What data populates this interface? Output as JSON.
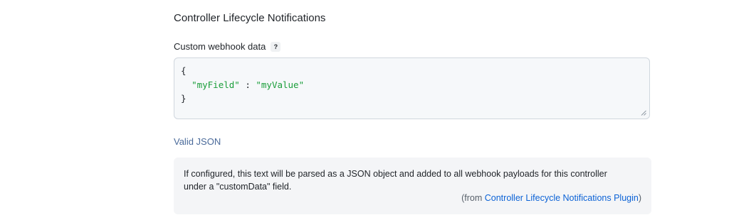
{
  "section": {
    "title": "Controller Lifecycle Notifications"
  },
  "field": {
    "label": "Custom webhook data",
    "help_icon_glyph": "?",
    "help_icon": "question-icon"
  },
  "editor": {
    "lines": {
      "open": "{",
      "key": "\"myField\"",
      "separator": " : ",
      "value": "\"myValue\"",
      "close": "}"
    },
    "string_color": "#1a9e3a",
    "resize_icon": "resize-grip-icon"
  },
  "validation": {
    "status": "Valid JSON",
    "color": "#4a6a9a"
  },
  "help": {
    "text": "If configured, this text will be parsed as a JSON object and added to all webhook payloads for this controller under a \"customData\" field.",
    "source_prefix": "(from ",
    "source_link": "Controller Lifecycle Notifications Plugin",
    "source_suffix": ")",
    "link_color": "#0b62d6"
  }
}
